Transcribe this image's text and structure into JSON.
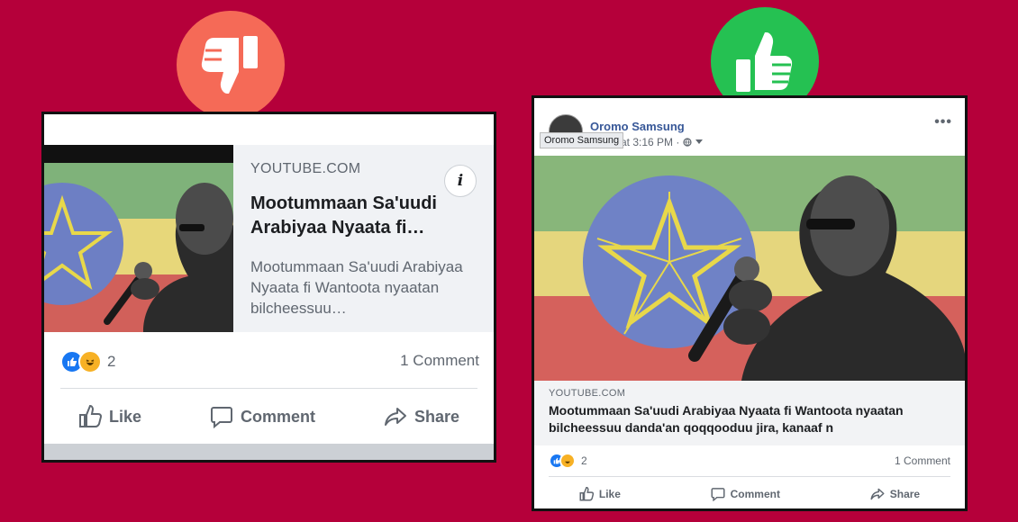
{
  "colors": {
    "background": "#b5003a",
    "badge_bad": "#f56a57",
    "badge_good": "#25c152",
    "facebook_blue": "#385898"
  },
  "badges": {
    "bad_icon": "thumbs-down-icon",
    "good_icon": "thumbs-up-icon"
  },
  "left_post": {
    "link": {
      "domain": "YOUTUBE.COM",
      "title": "Mootummaan Sa'uudi Arabiyaa Nyaata fi…",
      "description": "Mootummaan Sa'uudi Arabiyaa Nyaata fi Wantoota nyaatan bilcheessuu…",
      "info_icon_label": "i"
    },
    "reactions": {
      "count": "2",
      "types": [
        "like",
        "haha"
      ]
    },
    "comments": "1 Comment",
    "actions": {
      "like": "Like",
      "comment": "Comment",
      "share": "Share"
    }
  },
  "right_post": {
    "author": "Oromo Samsung",
    "tooltip": "Oromo Samsung",
    "time": "at 3:16 PM ·",
    "more_label": "•••",
    "link": {
      "domain": "YOUTUBE.COM",
      "title": "Mootummaan Sa'uudi Arabiyaa Nyaata fi Wantoota nyaatan bilcheessuu danda'an qoqqooduu jira, kanaaf n"
    },
    "reactions": {
      "count": "2",
      "types": [
        "like",
        "haha"
      ]
    },
    "comments": "1 Comment",
    "actions": {
      "like": "Like",
      "comment": "Comment",
      "share": "Share"
    }
  }
}
